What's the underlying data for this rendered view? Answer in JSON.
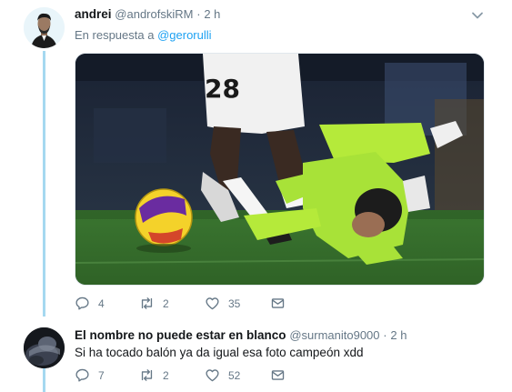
{
  "tweets": [
    {
      "name": "andrei",
      "handle": "@androfskiRM",
      "dot": "·",
      "time": "2 h",
      "reply_prefix": "En respuesta a",
      "reply_mention": "@gerorulli",
      "replies": "4",
      "retweets": "2",
      "likes": "35"
    },
    {
      "name": "El nombre no puede estar en blanco",
      "handle": "@surmanito9000",
      "dot": "·",
      "time": "2 h",
      "text": "Si ha tocado balón ya da igual esa foto campeón xdd",
      "replies": "7",
      "retweets": "2",
      "likes": "52"
    }
  ],
  "icons": {
    "reply": "reply-icon",
    "retweet": "retweet-icon",
    "like": "heart-icon",
    "dm": "envelope-icon",
    "more": "chevron-down-icon"
  },
  "colors": {
    "link": "#1da1f2",
    "muted": "#657786",
    "thread": "#a5d8f0",
    "pitch": "#3e7a2e"
  }
}
